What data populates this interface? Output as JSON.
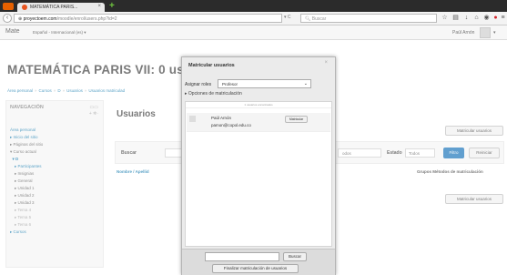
{
  "browser": {
    "tab_title": "MATEMÁTICA PARIS...",
    "tab_close": "×",
    "new_tab": "+",
    "url_host": "proyectoem.com",
    "url_path": "/moodle/enrol/users.php?id=2",
    "search_placeholder": "Buscar",
    "icons": [
      "back-arrow-icon",
      "reload-icon",
      "star-icon",
      "clipboard-icon",
      "download-icon",
      "home-icon",
      "chat-icon",
      "circle-icon",
      "menu-icon"
    ]
  },
  "moodle_header": {
    "site_short": "Mate",
    "language": "Español - Internacional (es) ▾",
    "user_name": "Paúl Arnón",
    "user_caret": "▾"
  },
  "page": {
    "title": "MATEMÁTICA PARIS VII: 0 us",
    "breadcrumb": [
      "Área personal",
      "Cursos",
      "D",
      "Usuarios",
      "Usuarios matriculad"
    ],
    "breadcrumb_sep": "»"
  },
  "navigation": {
    "heading": "NAVEGACIÓN",
    "controls_top": "▭▭",
    "controls_bottom": "+ ✲·",
    "items": [
      {
        "label": "Área personal",
        "style": ""
      },
      {
        "label": "▸ Inicio del sitio",
        "style": ""
      },
      {
        "label": "▸ Páginas del sitio",
        "style": "plain"
      },
      {
        "label": "▾ Curso actual",
        "style": "plain"
      },
      {
        "label": "  ▾ D",
        "style": "bold"
      },
      {
        "label": "    ▸ Participantes",
        "style": ""
      },
      {
        "label": "    ▸ Insignias",
        "style": "plain"
      },
      {
        "label": "    ▸ General",
        "style": "plain"
      },
      {
        "label": "    ▸ Unidad 1",
        "style": "plain"
      },
      {
        "label": "    ▸ Unidad 2",
        "style": "plain"
      },
      {
        "label": "    ▸ Unidad 3",
        "style": "plain"
      },
      {
        "label": "    ▸ Tema 4",
        "style": "dim"
      },
      {
        "label": "    ▸ Tema 5",
        "style": "dim"
      },
      {
        "label": "    ▸ Tema 6",
        "style": "dim"
      },
      {
        "label": "▸ Cursos",
        "style": ""
      }
    ]
  },
  "main": {
    "heading": "Usuarios",
    "enrol_button": "Matricular usuarios",
    "filter": {
      "search_label": "Buscar",
      "methods_value": "odos",
      "estado_label": "Estado",
      "estado_value": "Todos",
      "filter_button": "Filtro",
      "reset_button": "Reiniciar"
    },
    "columns": {
      "name": "Nombre / Apellid",
      "groups": "Grupos Métodos de matriculación"
    }
  },
  "dialog": {
    "title": "Matricular usuarios",
    "close": "×",
    "role_label": "Asignar roles",
    "role_value": "Profesor",
    "options_link": "▸ Opciones de matriculación",
    "count_text": "1 usuarios encontrados",
    "users": [
      {
        "name": "Paúl Arnón",
        "email": "pamon@copol.edu.co",
        "button": "Matricular"
      }
    ],
    "search_button": "Buscar",
    "finish_button": "Finalizar matriculación de usuarios"
  },
  "colors": {
    "link": "#0070a8",
    "primary_button": "#0d6cb5",
    "tab_bar": "#2b2b2b"
  }
}
